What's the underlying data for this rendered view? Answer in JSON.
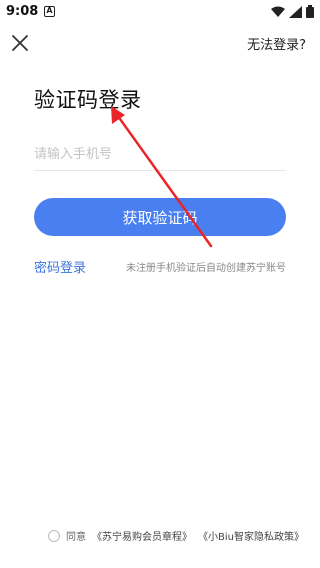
{
  "status_bar": {
    "time": "9:08",
    "notif_glyph": "A"
  },
  "header": {
    "close_icon": "close-icon",
    "cannot_login": "无法登录?"
  },
  "title": "验证码登录",
  "phone_input": {
    "value": "",
    "placeholder": "请输入手机号"
  },
  "get_code_button": "获取验证码",
  "password_login_link": "密码登录",
  "hint": "未注册手机验证后自动创建苏宁账号",
  "agreement": {
    "agree_label": "同意",
    "link1": "《苏宁易购会员章程》",
    "link2": "《小Biu智家隐私政策》"
  },
  "annotation": {
    "arrow_color": "#e8262a"
  },
  "colors": {
    "accent": "#4a7ff0",
    "link": "#3c74e0"
  }
}
